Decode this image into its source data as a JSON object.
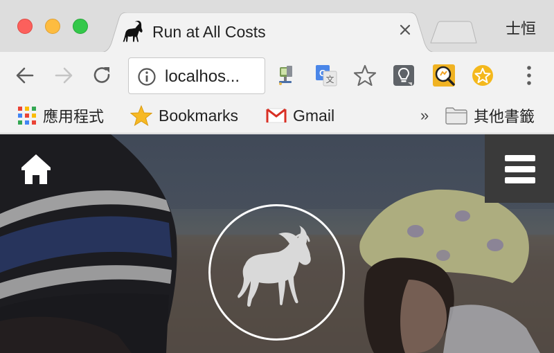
{
  "window": {
    "tab_title": "Run at All Costs",
    "profile_name": "士恒"
  },
  "toolbar": {
    "url": "localhos..."
  },
  "bookmarks": {
    "apps_label": "應用程式",
    "bookmarks_label": "Bookmarks",
    "gmail_label": "Gmail",
    "overflow_label": "»",
    "other_label": "其他書籤"
  },
  "icons": {
    "tab_favicon": "sable-antelope-icon",
    "tab_close": "close-icon",
    "nav_back": "arrow-left-icon",
    "nav_forward": "arrow-right-icon",
    "reload": "reload-icon",
    "site_info": "info-icon",
    "extensions": [
      "network-monitor-icon",
      "google-translate-icon",
      "star-icon",
      "lightbulb-icon",
      "screen-capture-icon",
      "gold-star-badge-icon"
    ],
    "chrome_menu": "more-vertical-icon",
    "page_home": "home-icon",
    "page_menu": "hamburger-menu-icon",
    "page_logo": "sable-antelope-logo"
  },
  "colors": {
    "traffic_red": "#fc605c",
    "traffic_yellow": "#fdbc40",
    "traffic_green": "#34c84a",
    "menu_button_bg": "#3a3a3a"
  }
}
